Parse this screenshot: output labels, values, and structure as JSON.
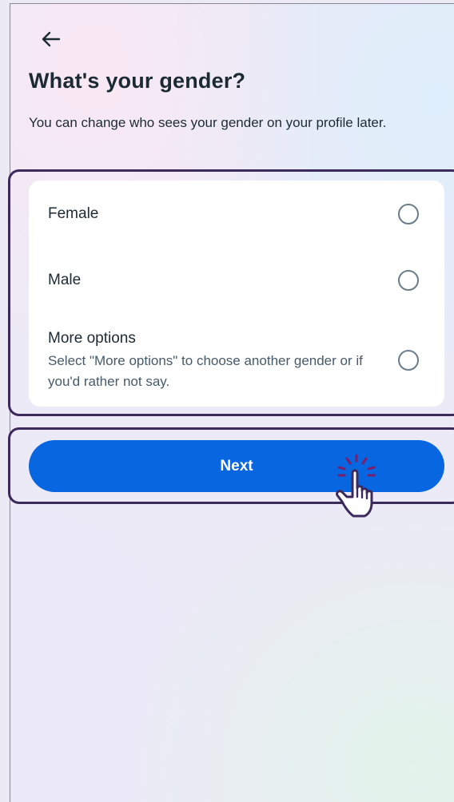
{
  "header": {
    "title": "What's your gender?",
    "subtitle": "You can change who sees your gender on your profile later."
  },
  "options": [
    {
      "label": "Female",
      "description": "",
      "selected": false
    },
    {
      "label": "Male",
      "description": "",
      "selected": false
    },
    {
      "label": "More options",
      "description": "Select \"More options\" to choose another gender or if you'd rather not say.",
      "selected": false
    }
  ],
  "next_button": {
    "label": "Next"
  },
  "colors": {
    "primary": "#0866e0",
    "text": "#1c2b33",
    "secondary_text": "#465a69",
    "highlight_border": "#3d2a5c"
  },
  "icons": {
    "back": "back-arrow-icon",
    "cursor": "hand-pointer-icon"
  }
}
